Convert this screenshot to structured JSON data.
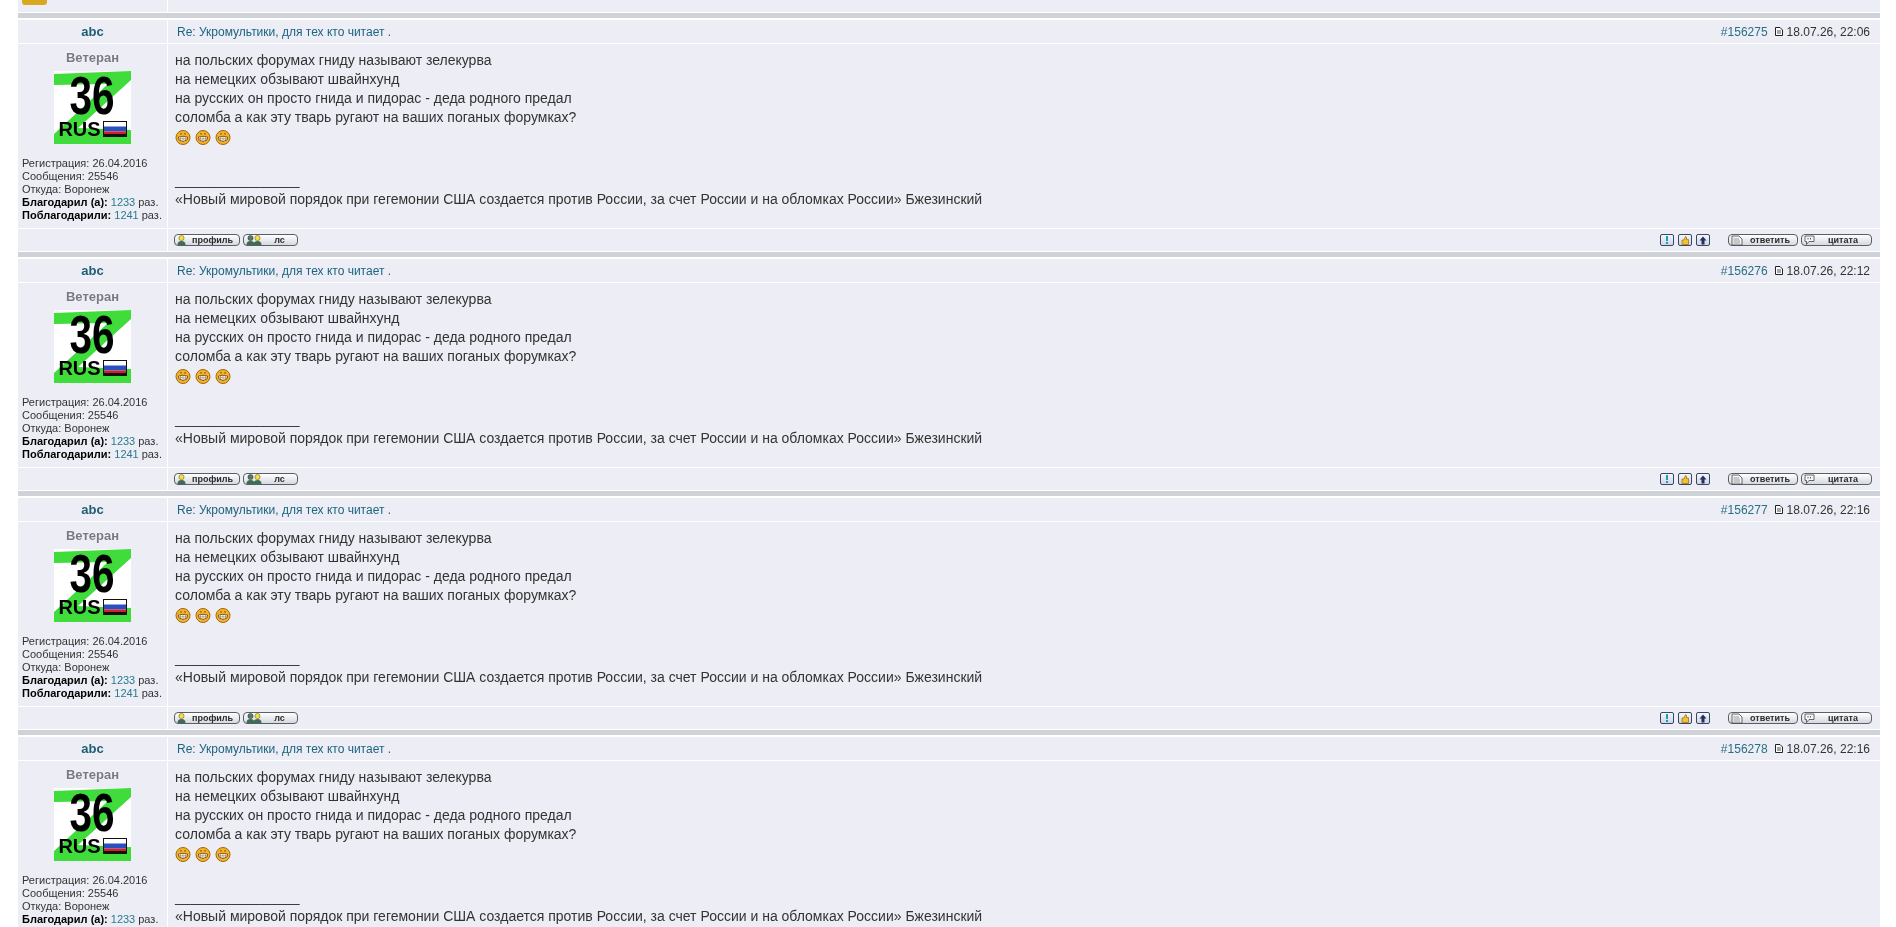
{
  "posts": [
    {
      "author": "abc",
      "subject": "Re: Укромультики, для тех кто читает .",
      "post_number": "#156275",
      "date": "18.07.26, 22:06",
      "rank": "Ветеран",
      "avatar": {
        "number": "36",
        "label": "RUS"
      },
      "stats": [
        {
          "kind": "plain",
          "text": "Регистрация: 26.04.2016"
        },
        {
          "kind": "plain",
          "text": "Сообщения: 25546"
        },
        {
          "kind": "plain",
          "text": "Откуда: Воронеж"
        },
        {
          "kind": "count",
          "label": "Благодарил (а):",
          "value": "1233",
          "suffix": "раз."
        },
        {
          "kind": "count",
          "label": "Поблагодарили:",
          "value": "1241",
          "suffix": "раз."
        }
      ],
      "message": [
        "на польских форумах гниду называют зелекурва",
        "на немецких обзывают швайнхунд",
        "на русских он просто гнида и пидорас - деда родного предал",
        "соломба а как эту тварь ругают на ваших поганых форумках?"
      ],
      "signature": {
        "rule": "________________",
        "quote": "«Новый мировой порядок при гегемонии США создается против России, за счет России и на обломках России» Бжезинский"
      },
      "buttons_left": [
        {
          "kind": "profile",
          "label": "профиль"
        },
        {
          "kind": "pm",
          "label": "лс"
        }
      ],
      "buttons_right": [
        {
          "kind": "reply",
          "label": "ответить"
        },
        {
          "kind": "quote",
          "label": "цитата"
        }
      ]
    },
    {
      "author": "abc",
      "subject": "Re: Укромультики, для тех кто читает .",
      "post_number": "#156276",
      "date": "18.07.26, 22:12",
      "rank": "Ветеран",
      "avatar": {
        "number": "36",
        "label": "RUS"
      },
      "stats": [
        {
          "kind": "plain",
          "text": "Регистрация: 26.04.2016"
        },
        {
          "kind": "plain",
          "text": "Сообщения: 25546"
        },
        {
          "kind": "plain",
          "text": "Откуда: Воронеж"
        },
        {
          "kind": "count",
          "label": "Благодарил (а):",
          "value": "1233",
          "suffix": "раз."
        },
        {
          "kind": "count",
          "label": "Поблагодарили:",
          "value": "1241",
          "suffix": "раз."
        }
      ],
      "message": [
        "на польских форумах гниду называют зелекурва",
        "на немецких обзывают швайнхунд",
        "на русских он просто гнида и пидорас - деда родного предал",
        "соломба а как эту тварь ругают на ваших поганых форумках?"
      ],
      "signature": {
        "rule": "________________",
        "quote": "«Новый мировой порядок при гегемонии США создается против России, за счет России и на обломках России» Бжезинский"
      },
      "buttons_left": [
        {
          "kind": "profile",
          "label": "профиль"
        },
        {
          "kind": "pm",
          "label": "лс"
        }
      ],
      "buttons_right": [
        {
          "kind": "reply",
          "label": "ответить"
        },
        {
          "kind": "quote",
          "label": "цитата"
        }
      ]
    },
    {
      "author": "abc",
      "subject": "Re: Укромультики, для тех кто читает .",
      "post_number": "#156277",
      "date": "18.07.26, 22:16",
      "rank": "Ветеран",
      "avatar": {
        "number": "36",
        "label": "RUS"
      },
      "stats": [
        {
          "kind": "plain",
          "text": "Регистрация: 26.04.2016"
        },
        {
          "kind": "plain",
          "text": "Сообщения: 25546"
        },
        {
          "kind": "plain",
          "text": "Откуда: Воронеж"
        },
        {
          "kind": "count",
          "label": "Благодарил (а):",
          "value": "1233",
          "suffix": "раз."
        },
        {
          "kind": "count",
          "label": "Поблагодарили:",
          "value": "1241",
          "suffix": "раз."
        }
      ],
      "message": [
        "на польских форумах гниду называют зелекурва",
        "на немецких обзывают швайнхунд",
        "на русских он просто гнида и пидорас - деда родного предал",
        "соломба а как эту тварь ругают на ваших поганых форумках?"
      ],
      "signature": {
        "rule": "________________",
        "quote": "«Новый мировой порядок при гегемонии США создается против России, за счет России и на обломках России» Бжезинский"
      },
      "buttons_left": [
        {
          "kind": "profile",
          "label": "профиль"
        },
        {
          "kind": "pm",
          "label": "лс"
        }
      ],
      "buttons_right": [
        {
          "kind": "reply",
          "label": "ответить"
        },
        {
          "kind": "quote",
          "label": "цитата"
        }
      ]
    },
    {
      "author": "abc",
      "subject": "Re: Укромультики, для тех кто читает .",
      "post_number": "#156278",
      "date": "18.07.26, 22:16",
      "rank": "Ветеран",
      "avatar": {
        "number": "36",
        "label": "RUS"
      },
      "stats": [
        {
          "kind": "plain",
          "text": "Регистрация: 26.04.2016"
        },
        {
          "kind": "plain",
          "text": "Сообщения: 25546"
        },
        {
          "kind": "plain",
          "text": "Откуда: Воронеж"
        },
        {
          "kind": "count",
          "label": "Благодарил (а):",
          "value": "1233",
          "suffix": "раз."
        }
      ],
      "message": [
        "на польских форумах гниду называют зелекурва",
        "на немецких обзывают швайнхунд",
        "на русских он просто гнида и пидорас - деда родного предал",
        "соломба а как эту тварь ругают на ваших поганых форумках?"
      ],
      "signature": {
        "rule": "________________",
        "quote": "«Новый мировой порядок при гегемонии США создается против России, за счет России и на обломках России» Бжезинский"
      }
    }
  ]
}
